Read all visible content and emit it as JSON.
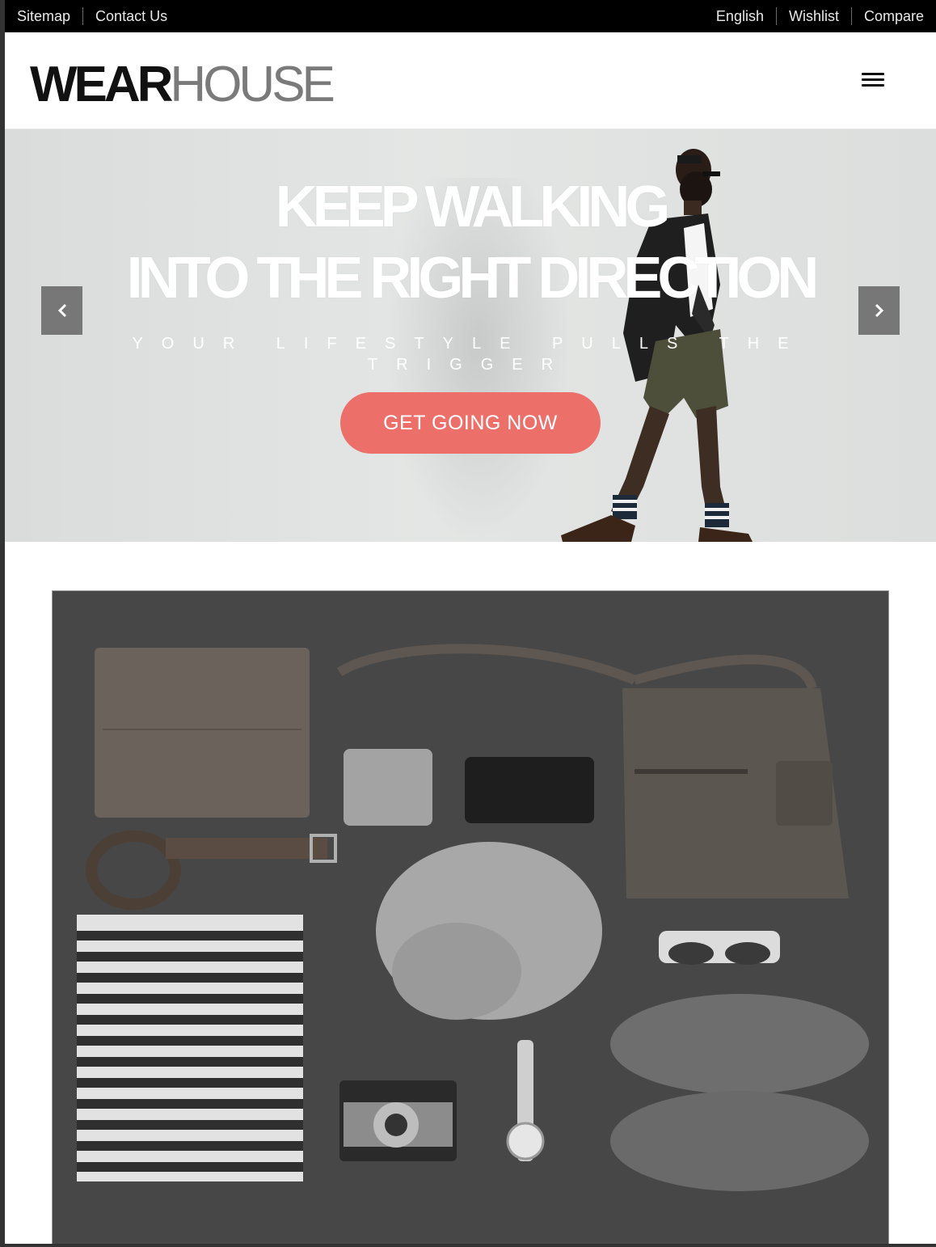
{
  "topbar": {
    "left_links": [
      "Sitemap",
      "Contact Us"
    ],
    "right_links": [
      "English",
      "Wishlist",
      "Compare"
    ]
  },
  "header": {
    "logo_bold": "WEAR",
    "logo_light": "HOUSE",
    "menu_icon": "hamburger-menu-icon"
  },
  "hero": {
    "headline_1": "KEEP WALKING",
    "headline_2": "INTO THE RIGHT DIRECTION",
    "tagline": "YOUR LIFESTYLE PULLS THE TRIGGER",
    "cta_label": "GET GOING NOW",
    "prev_icon": "chevron-left-icon",
    "next_icon": "chevron-right-icon"
  },
  "colors": {
    "accent": "#ec6f6a",
    "topbar_bg": "#000000",
    "hero_bg": "#e1e3e2",
    "arrow_bg": "#777777"
  }
}
